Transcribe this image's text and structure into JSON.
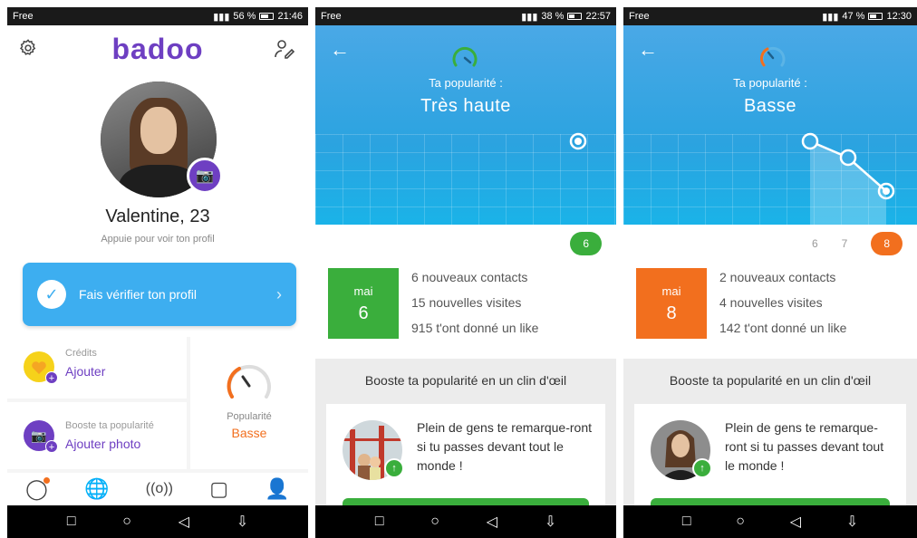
{
  "colors": {
    "brand": "#6e3fc2",
    "blue": "#3daef0",
    "green": "#3aae3c",
    "orange": "#f26f1e"
  },
  "phone1": {
    "status": {
      "carrier": "Free",
      "battery": "56 %",
      "time": "21:46"
    },
    "logo": "badoo",
    "name": "Valentine, 23",
    "subtitle": "Appuie pour voir ton profil",
    "verify_label": "Fais vérifier ton profil",
    "credits": {
      "label": "Crédits",
      "action": "Ajouter"
    },
    "boost": {
      "label": "Booste ta popularité",
      "action": "Ajouter photo"
    },
    "popularity": {
      "label": "Popularité",
      "value": "Basse"
    },
    "tabs": [
      "chat-icon",
      "globe-icon",
      "radar-icon",
      "cards-icon",
      "profile-icon"
    ]
  },
  "phone2": {
    "status": {
      "carrier": "Free",
      "battery": "38 %",
      "time": "22:57"
    },
    "title": "Ta popularité :",
    "level": "Très haute",
    "days": [
      "6"
    ],
    "date": {
      "month": "mai",
      "day": "6"
    },
    "stats": [
      "6 nouveaux contacts",
      "15 nouvelles visites",
      "915 t'ont donné un like"
    ],
    "boost_title": "Booste ta popularité en un clin d'œil",
    "boost_msg": "Plein de gens te remarque-ront si tu passes devant tout le monde !"
  },
  "phone3": {
    "status": {
      "carrier": "Free",
      "battery": "47 %",
      "time": "12:30"
    },
    "title": "Ta popularité :",
    "level": "Basse",
    "days": [
      "6",
      "7",
      "8"
    ],
    "date": {
      "month": "mai",
      "day": "8"
    },
    "stats": [
      "2 nouveaux contacts",
      "4 nouvelles visites",
      "142 t'ont donné un like"
    ],
    "boost_title": "Booste ta popularité en un clin d'œil",
    "boost_msg": "Plein de gens te remarque-ront si tu passes devant tout le monde !"
  }
}
